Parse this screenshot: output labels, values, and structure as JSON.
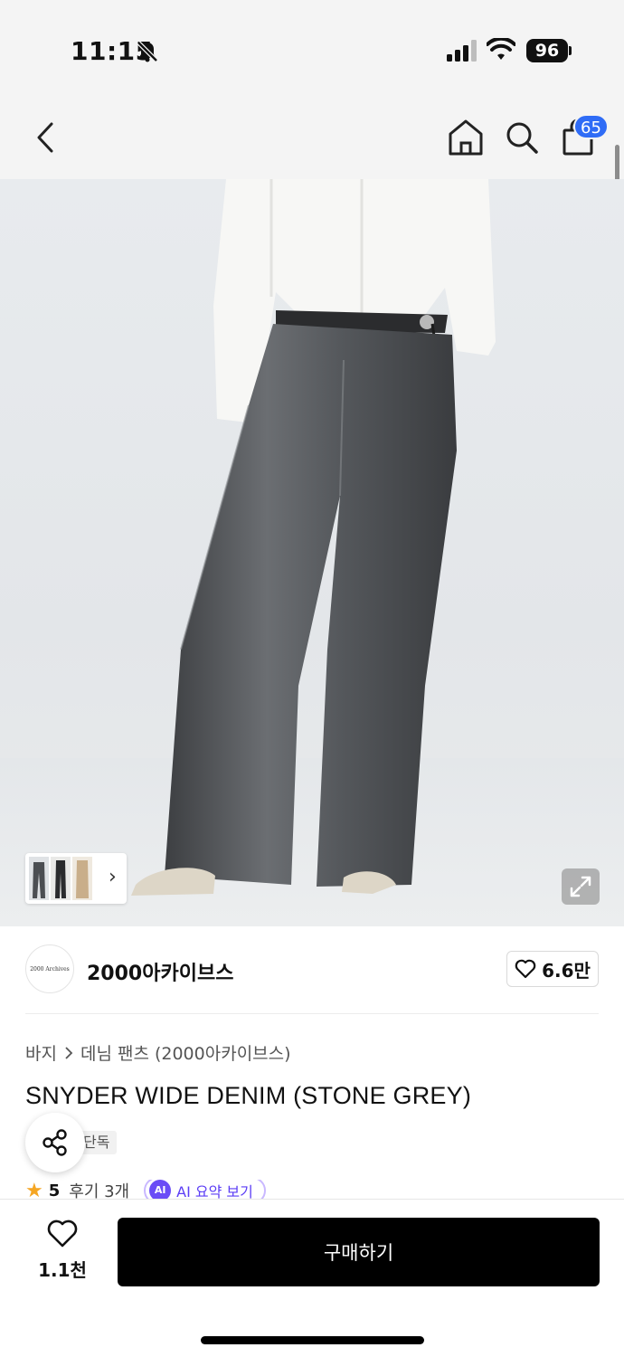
{
  "status": {
    "time": "11:15",
    "battery": "96"
  },
  "nav": {
    "cart_count": "65",
    "icons": [
      "chevron-left-icon",
      "home-icon",
      "search-icon",
      "shopping-bag-icon"
    ]
  },
  "brand": {
    "logo_text": "2000 Archives",
    "name": "2000아카이브스",
    "likes": "6.6만"
  },
  "breadcrumb": {
    "category": "바지",
    "subcategory": "데님 팬츠 (2000아카이브스)"
  },
  "product": {
    "title": "SNYDER WIDE DENIM (STONE GREY)",
    "badge": "단독"
  },
  "rating": {
    "score": "5",
    "reviews": "후기 3개",
    "ai_badge": "AI",
    "ai_label": "AI 요약 보기"
  },
  "bottom": {
    "wish_count": "1.1천",
    "buy_label": "구매하기"
  },
  "colors": {
    "accent_blue": "#2f6cf6",
    "buy_button": "#000000",
    "ai_purple": "#6a4cf6",
    "star": "#f5a623"
  }
}
